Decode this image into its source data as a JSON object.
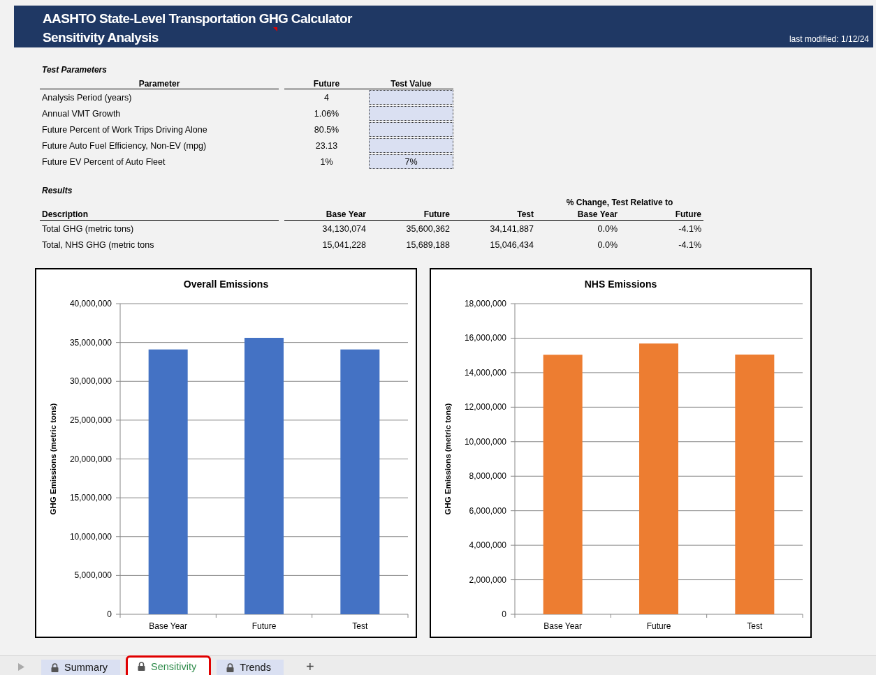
{
  "header": {
    "title": "AASHTO State-Level Transportation GHG Calculator",
    "subtitle": "Sensitivity Analysis",
    "modified": "last modified: 1/12/24"
  },
  "test_parameters": {
    "heading": "Test Parameters",
    "columns": [
      "Parameter",
      "Future",
      "Test Value"
    ],
    "rows": [
      {
        "parameter": "Analysis Period (years)",
        "future": "4"
      },
      {
        "parameter": "Annual VMT Growth",
        "future": "1.06%"
      },
      {
        "parameter": "Future Percent of Work Trips Driving Alone",
        "future": "80.5%"
      },
      {
        "parameter": "Future Auto Fuel Efficiency, Non-EV (mpg)",
        "future": "23.13"
      },
      {
        "parameter": "Future EV Percent of Auto Fleet",
        "future": "1%",
        "test_value": "7%"
      }
    ]
  },
  "results": {
    "heading": "Results",
    "group_header": "% Change, Test Relative to",
    "columns": [
      "Description",
      "Base Year",
      "Future",
      "Test",
      "Base Year",
      "Future"
    ],
    "rows": [
      [
        "Total GHG (metric tons)",
        "34,130,074",
        "35,600,362",
        "34,141,887",
        "0.0%",
        "-4.1%"
      ],
      [
        "Total, NHS GHG (metric tons",
        "15,041,228",
        "15,689,188",
        "15,046,434",
        "0.0%",
        "-4.1%"
      ]
    ]
  },
  "charts": [
    {
      "chart_data": {
        "type": "bar",
        "title": "Overall Emissions",
        "ylabel": "GHG Emissions (metric tons)",
        "categories": [
          "Base Year",
          "Future",
          "Test"
        ],
        "grid": true,
        "series": [
          {
            "color": "#4472c4",
            "values": [
              34100000,
              35600000,
              34100000
            ]
          }
        ],
        "ylim": [
          0,
          40000000
        ],
        "yticks": [
          {
            "value": 0,
            "label": "0"
          },
          {
            "value": 5000000,
            "label": "5,000,000"
          },
          {
            "value": 10000000,
            "label": "10,000,000"
          },
          {
            "value": 15000000,
            "label": "15,000,000"
          },
          {
            "value": 20000000,
            "label": "20,000,000"
          },
          {
            "value": 25000000,
            "label": "25,000,000"
          },
          {
            "value": 30000000,
            "label": "30,000,000"
          },
          {
            "value": 35000000,
            "label": "35,000,000"
          },
          {
            "value": 40000000,
            "label": "40,000,000"
          }
        ]
      }
    },
    {
      "chart_data": {
        "type": "bar",
        "title": "NHS Emissions",
        "ylabel": "GHG Emissions (metric tons)",
        "categories": [
          "Base Year",
          "Future",
          "Test"
        ],
        "grid": true,
        "series": [
          {
            "color": "#ed7d31",
            "values": [
              15040000,
              15690000,
              15050000
            ]
          }
        ],
        "ylim": [
          0,
          18000000
        ],
        "yticks": [
          {
            "value": 0,
            "label": "0"
          },
          {
            "value": 2000000,
            "label": "2,000,000"
          },
          {
            "value": 4000000,
            "label": "4,000,000"
          },
          {
            "value": 6000000,
            "label": "6,000,000"
          },
          {
            "value": 8000000,
            "label": "8,000,000"
          },
          {
            "value": 10000000,
            "label": "10,000,000"
          },
          {
            "value": 12000000,
            "label": "12,000,000"
          },
          {
            "value": 14000000,
            "label": "14,000,000"
          },
          {
            "value": 16000000,
            "label": "16,000,000"
          },
          {
            "value": 18000000,
            "label": "18,000,000"
          }
        ]
      }
    }
  ],
  "sheet_tabs": [
    {
      "label": "Summary",
      "selected": false
    },
    {
      "label": "Sensitivity",
      "selected": true
    },
    {
      "label": "Trends",
      "selected": false
    }
  ],
  "add_tab": "+"
}
